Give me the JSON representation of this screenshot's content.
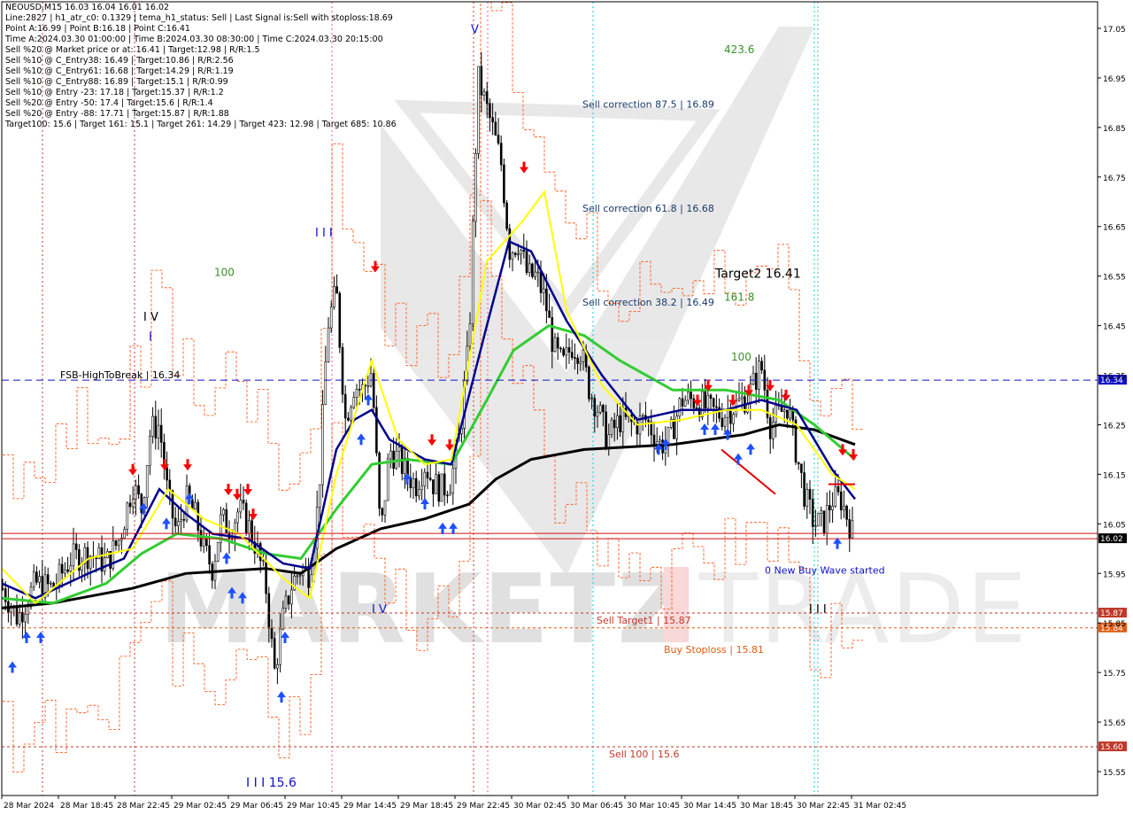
{
  "header": {
    "symbol_line": "NEOUSD,M15  16.03 16.04 16.01 16.02",
    "lines": [
      "Line:2827  |  h1_atr_c0: 0.1329  |  tema_h1_status: Sell  |  Last Signal is:Sell with stoploss:18.69",
      "Point A:16.99  |  Point B:16.18  |  Point C:16.41",
      "Time A:2024.03.30 01:00:00  |  Time B:2024.03.30 08:30:00  |  Time C:2024.03.30 20:15:00",
      "Sell %20 @ Market price or at: 16.41  |  Target:12.98  |  R/R:1.5",
      "Sell %10 @ C_Entry38: 16.49  |  Target:10.86  |  R/R:2.56",
      "Sell %10 @ C_Entry61: 16.68  |  Target:14.29  |  R/R:1.19",
      "Sell %10 @ C_Entry88: 16.89  |  Target:15.1  |  R/R:0.99",
      "Sell %10 @ Entry -23: 17.18  |  Target:15.37  |  R/R:1.2",
      "Sell %20 @ Entry -50: 17.4  |  Target:15.6  |  R/R:1.4",
      "Sell %20 @ Entry -88: 17.71  |  Target:15.87  |  R/R:1.88",
      "Target100: 15.6  |  Target 161: 15.1  |  Target 261: 14.29  |  Target 423: 12.98  |  Target 685: 10.86"
    ]
  },
  "chart_data": {
    "type": "candlestick",
    "symbol": "NEOUSD",
    "timeframe": "M15",
    "last_price": 16.02,
    "ohlc_last": {
      "open": 16.03,
      "high": 16.04,
      "low": 16.01,
      "close": 16.02
    },
    "ylim": [
      15.5,
      17.08
    ],
    "y_ticks": [
      "17.05",
      "16.95",
      "16.85",
      "16.75",
      "16.65",
      "16.55",
      "16.45",
      "16.35",
      "16.25",
      "16.15",
      "16.05",
      "15.95",
      "15.85",
      "15.75",
      "15.65",
      "15.55"
    ],
    "x_ticks": [
      "28 Mar 2024",
      "28 Mar 18:45",
      "28 Mar 22:45",
      "29 Mar 02:45",
      "29 Mar 06:45",
      "29 Mar 10:45",
      "29 Mar 14:45",
      "29 Mar 18:45",
      "29 Mar 22:45",
      "30 Mar 02:45",
      "30 Mar 06:45",
      "30 Mar 10:45",
      "30 Mar 14:45",
      "30 Mar 18:45",
      "30 Mar 22:45",
      "31 Mar 02:45"
    ],
    "horizontal_levels": [
      {
        "name": "FSB-HighToBreak",
        "label": "FSB-HighToBreak | 16.34",
        "value": 16.34,
        "color": "#1010c8",
        "badge": "16.34"
      },
      {
        "name": "Current price",
        "value": 16.02,
        "color": "#d01010",
        "badge": "16.02"
      },
      {
        "name": "Sell Target1",
        "label": "Sell Target1 | 15.87",
        "value": 15.87,
        "color": "#c0392b",
        "badge": "15.87"
      },
      {
        "name": "Buy Stoploss",
        "label": "Buy Stoploss | 15.81",
        "value": 15.84,
        "color": "#e05a10",
        "badge": "15.84"
      },
      {
        "name": "Sell 100",
        "label": "Sell 100 | 15.6",
        "value": 15.6,
        "color": "#c0392b",
        "badge": "15.60"
      }
    ],
    "annotations": [
      {
        "text": "Sell correction 87.5 | 16.89",
        "value": 16.89
      },
      {
        "text": "Sell correction 61.8 | 16.68",
        "value": 16.68
      },
      {
        "text": "Sell correction 38.2 | 16.49",
        "value": 16.49
      },
      {
        "text": "423.6",
        "value": 17.0
      },
      {
        "text": "Target2 16.41",
        "value": 16.55
      },
      {
        "text": "161.8",
        "value": 16.5
      },
      {
        "text": "100",
        "value": 16.38
      },
      {
        "text": "100",
        "value": 16.55
      },
      {
        "text": "0 New Buy Wave started",
        "value": 15.95
      },
      {
        "text": "I V",
        "value": 16.46
      },
      {
        "text": "I",
        "value": 16.42
      },
      {
        "text": "I I I",
        "value": 16.63
      },
      {
        "text": "V",
        "value": 17.04
      },
      {
        "text": "I V",
        "value": 15.87
      },
      {
        "text": "I I I 15.6",
        "value": 15.52
      },
      {
        "text": "I I I",
        "value": 15.87
      }
    ]
  },
  "colors": {
    "background": "#ffffff",
    "grid": "#9a9a9a",
    "candle": "#000000",
    "ma_black": "#000000",
    "ma_green": "#33cc33",
    "ma_navy": "#00008b",
    "ma_yellow": "#ffff00",
    "channel": "#ff4500",
    "buy_arrow": "#1e50ff",
    "sell_arrow": "#ff0000",
    "fib_green": "#3a8f2a"
  }
}
